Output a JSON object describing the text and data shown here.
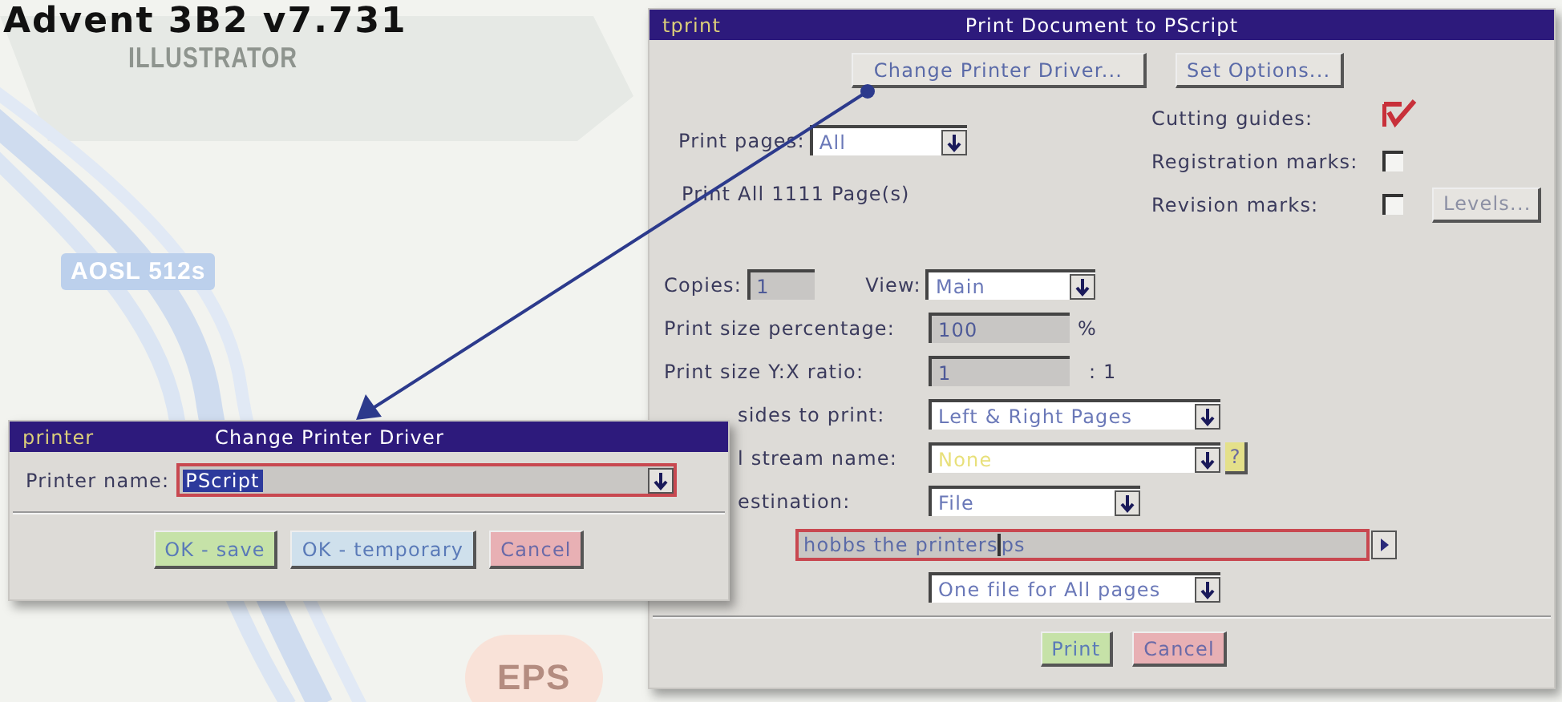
{
  "page_heading": "Advent 3B2 v7.731",
  "background_labels": [
    {
      "text": "ILLUSTRATOR"
    },
    {
      "text": "AOSL 512s"
    },
    {
      "text": "EPS"
    }
  ],
  "print_dialog": {
    "app": "tprint",
    "title": "Print Document to PScript",
    "top_buttons": [
      "Change Printer Driver...",
      "Set Options..."
    ],
    "print_pages": {
      "label": "Print pages:",
      "value": "All"
    },
    "page_summary": "Print All 1111 Page(s)",
    "marks": [
      {
        "label": "Cutting guides:",
        "checked": true
      },
      {
        "label": "Registration marks:",
        "checked": false
      },
      {
        "label": "Revision marks:",
        "checked": false,
        "button": {
          "label": "Levels...",
          "disabled": true
        }
      }
    ],
    "copies": {
      "label": "Copies:",
      "value": "1"
    },
    "view": {
      "label": "View:",
      "value": "Main"
    },
    "size_percentage": {
      "label": "Print size percentage:",
      "value": "100",
      "unit": "%"
    },
    "size_ratio": {
      "label": "Print size Y:X ratio:",
      "value": "1",
      "unit": ": 1"
    },
    "sides": {
      "label": "sides to print:",
      "value": "Left & Right Pages"
    },
    "stream": {
      "label": "l stream name:",
      "value": "None",
      "help": "?"
    },
    "destination": {
      "label": "estination:",
      "value": "File"
    },
    "file_path": {
      "before_cursor": "hobbs the printers",
      "after_cursor": "ps"
    },
    "file_mode": {
      "value": "One file for All pages"
    },
    "buttons": [
      {
        "label": "Print",
        "kind": "ok"
      },
      {
        "label": "Cancel",
        "kind": "cancel"
      }
    ]
  },
  "driver_dialog": {
    "app": "printer",
    "title": "Change Printer Driver",
    "printer_name": {
      "label": "Printer name:",
      "value": "PScript",
      "selected": true
    },
    "buttons": [
      {
        "label": "OK - save",
        "kind": "ok"
      },
      {
        "label": "OK - temporary",
        "kind": "temp"
      },
      {
        "label": "Cancel",
        "kind": "cancel"
      }
    ]
  }
}
